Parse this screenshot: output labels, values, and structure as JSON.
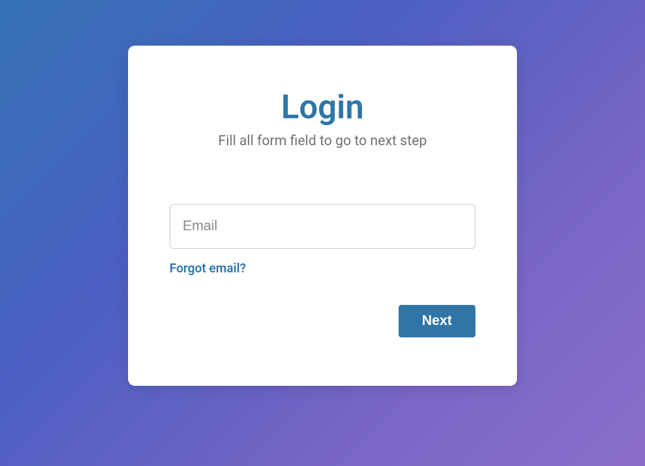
{
  "card": {
    "title": "Login",
    "subtitle": "Fill all form field to go to next step",
    "email_placeholder": "Email",
    "email_value": "",
    "forgot_link": "Forgot email?",
    "next_button": "Next"
  },
  "colors": {
    "accent": "#2f76a7",
    "gradient_start": "#3572b5",
    "gradient_end": "#8a6fc9"
  }
}
